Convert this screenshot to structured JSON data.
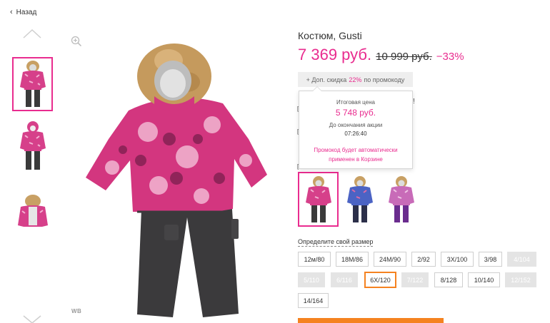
{
  "nav": {
    "back_label": "Назад"
  },
  "gallery": {
    "thumbnails": [
      {
        "variant": "pink-fur-hood",
        "active": true
      },
      {
        "variant": "pink-hood",
        "active": false
      },
      {
        "variant": "pink-open-back",
        "active": false
      }
    ],
    "watermark": "WB"
  },
  "product": {
    "title": "Костюм, Gusti",
    "price_current": "7 369 руб.",
    "price_old": "10 999 руб.",
    "discount": "−33%"
  },
  "promo": {
    "button_prefix": "+ Доп. скидка",
    "button_percent": "22%",
    "button_suffix": "по промокоду",
    "popup": {
      "final_label": "Итоговая цена",
      "final_price": "5 748 руб.",
      "until_label": "До окончания акции",
      "timer": "07:26:40",
      "auto_note": "Промокод будет автоматически применен в Корзине"
    }
  },
  "colors": [
    {
      "name": "pink",
      "selected": true
    },
    {
      "name": "blue",
      "selected": false
    },
    {
      "name": "purple",
      "selected": false
    }
  ],
  "sizes": {
    "title": "Определите свой размер",
    "items": [
      {
        "label": "12м/80",
        "state": "available"
      },
      {
        "label": "18M/86",
        "state": "available"
      },
      {
        "label": "24M/90",
        "state": "available"
      },
      {
        "label": "2/92",
        "state": "available"
      },
      {
        "label": "3X/100",
        "state": "available"
      },
      {
        "label": "3/98",
        "state": "available"
      },
      {
        "label": "4/104",
        "state": "unavailable"
      },
      {
        "label": "5/110",
        "state": "unavailable"
      },
      {
        "label": "6/116",
        "state": "unavailable"
      },
      {
        "label": "6X/120",
        "state": "selected"
      },
      {
        "label": "7/122",
        "state": "unavailable"
      },
      {
        "label": "8/128",
        "state": "available"
      },
      {
        "label": "10/140",
        "state": "available"
      },
      {
        "label": "12/152",
        "state": "unavailable"
      },
      {
        "label": "14/164",
        "state": "available"
      }
    ]
  },
  "colors_theme": {
    "accent": "#e92c8f",
    "cta": "#f58220",
    "disabled": "#e4e4e4"
  }
}
